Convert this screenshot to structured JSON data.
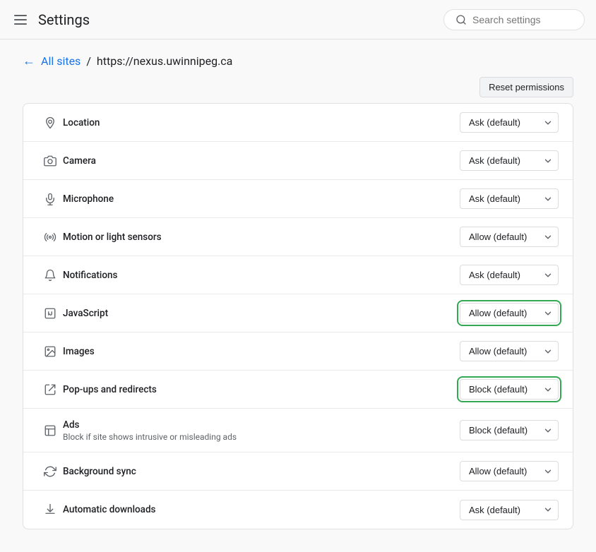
{
  "header": {
    "title": "Settings",
    "search_placeholder": "Search settings"
  },
  "breadcrumb": {
    "back_label": "←",
    "all_sites_label": "All sites",
    "separator": "/",
    "current_url": "https://nexus.uwinnipeg.ca"
  },
  "reset_button_label": "Reset permissions",
  "permissions": [
    {
      "id": "location",
      "label": "Location",
      "subtitle": "",
      "value": "Ask (default)",
      "highlighted": false,
      "icon": "location"
    },
    {
      "id": "camera",
      "label": "Camera",
      "subtitle": "",
      "value": "Ask (default)",
      "highlighted": false,
      "icon": "camera"
    },
    {
      "id": "microphone",
      "label": "Microphone",
      "subtitle": "",
      "value": "Ask (default)",
      "highlighted": false,
      "icon": "microphone"
    },
    {
      "id": "motion-sensors",
      "label": "Motion or light sensors",
      "subtitle": "",
      "value": "Allow (default)",
      "highlighted": false,
      "icon": "sensors"
    },
    {
      "id": "notifications",
      "label": "Notifications",
      "subtitle": "",
      "value": "Ask (default)",
      "highlighted": false,
      "icon": "notifications"
    },
    {
      "id": "javascript",
      "label": "JavaScript",
      "subtitle": "",
      "value": "Allow (default)",
      "highlighted": true,
      "icon": "javascript"
    },
    {
      "id": "images",
      "label": "Images",
      "subtitle": "",
      "value": "Allow (default)",
      "highlighted": false,
      "icon": "images"
    },
    {
      "id": "popups",
      "label": "Pop-ups and redirects",
      "subtitle": "",
      "value": "Block (default)",
      "highlighted": true,
      "icon": "popups"
    },
    {
      "id": "ads",
      "label": "Ads",
      "subtitle": "Block if site shows intrusive or misleading ads",
      "value": "Block (default)",
      "highlighted": false,
      "icon": "ads"
    },
    {
      "id": "background-sync",
      "label": "Background sync",
      "subtitle": "",
      "value": "Allow (default)",
      "highlighted": false,
      "icon": "sync"
    },
    {
      "id": "automatic-downloads",
      "label": "Automatic downloads",
      "subtitle": "",
      "value": "Ask (default)",
      "highlighted": false,
      "icon": "downloads"
    }
  ]
}
